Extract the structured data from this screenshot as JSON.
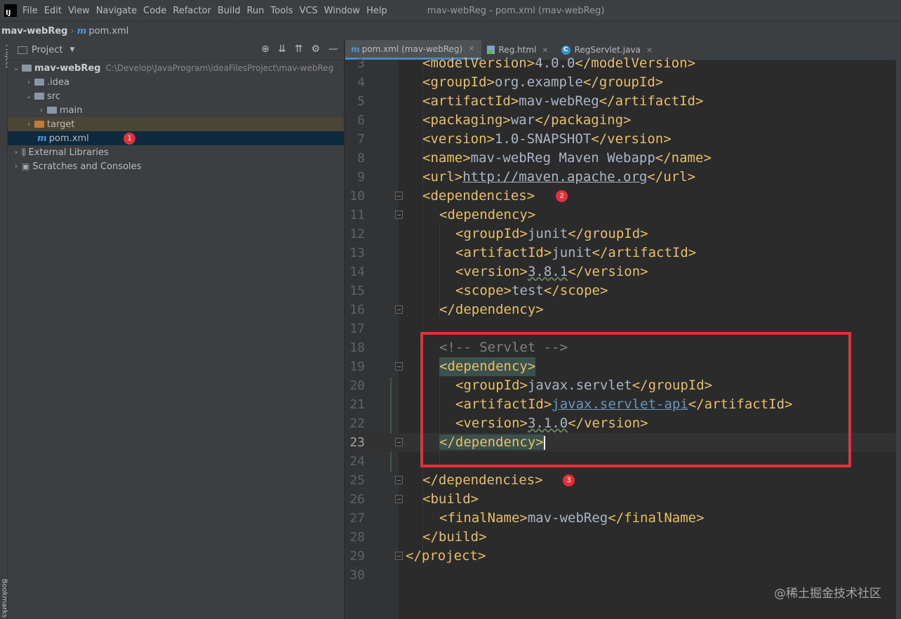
{
  "menubar": {
    "items": [
      "File",
      "Edit",
      "View",
      "Navigate",
      "Code",
      "Refactor",
      "Build",
      "Run",
      "Tools",
      "VCS",
      "Window",
      "Help"
    ],
    "window_title": "mav-webReg - pom.xml (mav-webReg)"
  },
  "navbar": {
    "project": "mav-webReg",
    "file": "pom.xml"
  },
  "left_strip": {
    "top_label": "Project",
    "bottom_label": "Bookmarks"
  },
  "project_panel": {
    "title": "Project",
    "tree": {
      "root_name": "mav-webReg",
      "root_path": "C:\\Develop\\JavaProgram\\ideaFilesProject\\mav-webReg",
      "idea": ".idea",
      "src": "src",
      "main": "main",
      "target": "target",
      "pom": "pom.xml",
      "external_libraries": "External Libraries",
      "scratches": "Scratches and Consoles"
    }
  },
  "tabs": [
    {
      "label": "pom.xml (mav-webReg)",
      "icon": "maven-icon",
      "active": true
    },
    {
      "label": "Reg.html",
      "icon": "html-file-icon",
      "active": false
    },
    {
      "label": "RegServlet.java",
      "icon": "java-class-icon",
      "active": false
    }
  ],
  "code": {
    "current_line": 23,
    "line_numbers": [
      "3",
      "4",
      "5",
      "6",
      "7",
      "8",
      "9",
      "10",
      "11",
      "12",
      "13",
      "14",
      "15",
      "16",
      "17",
      "18",
      "19",
      "20",
      "21",
      "22",
      "23",
      "24",
      "25",
      "26",
      "27",
      "28",
      "29",
      "30"
    ],
    "l3": {
      "tag": "modelVersion",
      "value": "4.0.0"
    },
    "l4": {
      "tag": "groupId",
      "value": "org.example"
    },
    "l5": {
      "tag": "artifactId",
      "value": "mav-webReg"
    },
    "l6": {
      "tag": "packaging",
      "value": "war"
    },
    "l7": {
      "tag": "version",
      "value": "1.0-SNAPSHOT"
    },
    "l8": {
      "tag": "name",
      "value": "mav-webReg Maven Webapp"
    },
    "l9": {
      "tag": "url",
      "value": "http://maven.apache.org"
    },
    "l10": "<dependencies>",
    "l11": "<dependency>",
    "l12": {
      "tag": "groupId",
      "value": "junit"
    },
    "l13": {
      "tag": "artifactId",
      "value": "junit"
    },
    "l14": {
      "tag": "version",
      "value": "3.8.1"
    },
    "l15": {
      "tag": "scope",
      "value": "test"
    },
    "l16": "</dependency>",
    "l18": "<!-- Servlet -->",
    "l19": "<dependency>",
    "l20": {
      "tag": "groupId",
      "value": "javax.servlet"
    },
    "l21": {
      "tag": "artifactId",
      "value": "javax.servlet-api"
    },
    "l22": {
      "tag": "version",
      "value": "3.1.0"
    },
    "l23": "</dependency>",
    "l25": "</dependencies>",
    "l26": "<build>",
    "l27": {
      "tag": "finalName",
      "value": "mav-webReg"
    },
    "l28": "</build>",
    "l29": "</project>"
  },
  "annotations": {
    "badge1": "1",
    "badge2": "2",
    "badge3": "3"
  },
  "watermark": "@稀土掘金技术社区",
  "colors": {
    "highlight_box": "#e5303c",
    "badge": "#e5303c",
    "tag": "#e8bf6a",
    "text": "#a9b7c6",
    "comment": "#808080"
  }
}
